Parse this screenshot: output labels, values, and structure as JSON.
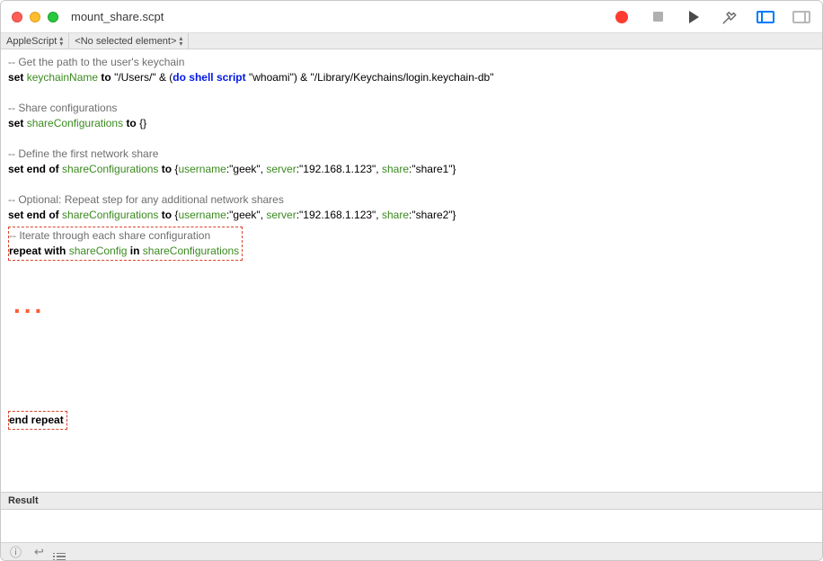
{
  "window": {
    "title": "mount_share.scpt"
  },
  "nav": {
    "language": "AppleScript",
    "element": "<No selected element>"
  },
  "code": {
    "c1": "-- Get the path to the user's keychain",
    "l2_set": "set",
    "l2_var": "keychainName",
    "l2_to": "to",
    "l2_s1": "\"/Users/\"",
    "l2_amp": " & (",
    "l2_cmd": "do shell script",
    "l2_s2": " \"whoami\") & \"/Library/Keychains/login.keychain-db\"",
    "c3": "-- Share configurations",
    "l4_set": "set",
    "l4_var": "shareConfigurations",
    "l4_to": "to",
    "l4_val": " {}",
    "c5": "-- Define the first network share",
    "l6_set": "set end of",
    "l6_var": "shareConfigurations",
    "l6_to": "to",
    "l6_b1": " {",
    "l6_k1": "username",
    "l6_v1": ":\"geek\", ",
    "l6_k2": "server",
    "l6_v2": ":\"192.168.1.123\", ",
    "l6_k3": "share",
    "l6_v3": ":\"share1\"}",
    "c7": "-- Optional: Repeat step for any additional network shares",
    "l8_set": "set end of",
    "l8_var": "shareConfigurations",
    "l8_to": "to",
    "l8_b1": " {",
    "l8_k1": "username",
    "l8_v1": ":\"geek\", ",
    "l8_k2": "server",
    "l8_v2": ":\"192.168.1.123\", ",
    "l8_k3": "share",
    "l8_v3": ":\"share2\"}",
    "c9": "-- Iterate through each share configuration",
    "l10_rep": "repeat with",
    "l10_v1": "shareConfig",
    "l10_in": "in",
    "l10_v2": "shareConfigurations",
    "ellipsis": "...",
    "end": "end repeat"
  },
  "result": {
    "label": "Result"
  },
  "footer": {
    "info": "ⓘ",
    "ret": "↩"
  }
}
